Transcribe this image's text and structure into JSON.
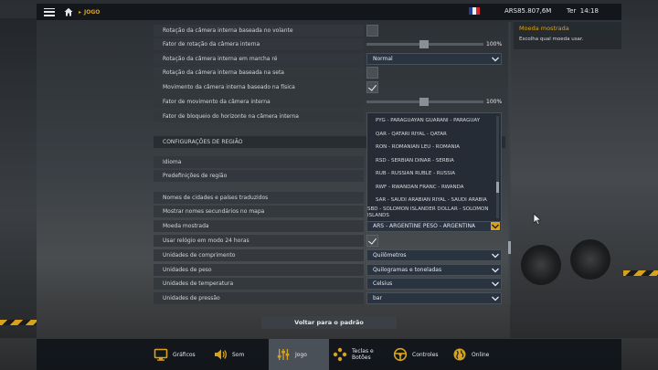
{
  "topbar": {
    "crumb": "JOGO",
    "money": "ARS85.807,6M",
    "clock_day": "Ter",
    "clock_time": "14:18"
  },
  "settings": {
    "rows_top": [
      {
        "label": "Rotação da câmera interna baseada no volante",
        "type": "checkbox",
        "checked": false
      },
      {
        "label": "Fator de rotação da câmera interna",
        "type": "slider",
        "value": 100,
        "display": "100%"
      },
      {
        "label": "Rotação da câmera interna em marcha ré",
        "type": "select",
        "value": "Normal"
      },
      {
        "label": "Rotação da câmera interna baseada na seta",
        "type": "checkbox",
        "checked": false
      },
      {
        "label": "Movimento da câmera interna baseado na física",
        "type": "checkbox",
        "checked": true
      },
      {
        "label": "Fator de movimento da câmera interna",
        "type": "slider",
        "value": 100,
        "display": "100%"
      },
      {
        "label": "Fator de bloqueio do horizonte na câmera interna",
        "type": "none"
      }
    ],
    "section_region": "CONFIGURAÇÕES DE REGIÃO",
    "rows_region": [
      {
        "label": "Idioma"
      },
      {
        "label": "Predefinições de região"
      }
    ],
    "rows_bottom": [
      {
        "label": "Nomes de cidades e países traduzidos",
        "type": "none"
      },
      {
        "label": "Mostrar nomes secundários no mapa",
        "type": "none"
      },
      {
        "label": "Moeda mostrada",
        "type": "select",
        "value": "ARS - ARGENTINE PESO - ARGENTINA",
        "open": true
      },
      {
        "label": "Usar relógio em modo 24 horas",
        "type": "checkbox",
        "checked": true
      },
      {
        "label": "Unidades de comprimento",
        "type": "select",
        "value": "Quilômetros"
      },
      {
        "label": "Unidades de peso",
        "type": "select",
        "value": "Quilogramas e toneladas"
      },
      {
        "label": "Unidades de temperatura",
        "type": "select",
        "value": "Celsius"
      },
      {
        "label": "Unidades de pressão",
        "type": "select",
        "value": "bar"
      }
    ],
    "currency_options": [
      "PYG - PARAGUAYAN GUARANI - PARAGUAY",
      "QAR - QATARI RIYAL - QATAR",
      "RON - ROMANIAN LEU - ROMANIA",
      "RSD - SERBIAN DINAR - SERBIA",
      "RUB - RUSSIAN RUBLE - RUSSIA",
      "RWF - RWANDAN FRANC - RWANDA",
      "SAR - SAUDI ARABIAN RIYAL - SAUDI ARABIA",
      "SBD - SOLOMON ISLANDER DOLLAR - SOLOMON ISLANDS"
    ]
  },
  "description": {
    "title": "Moeda mostrada",
    "body": "Escolha qual moeda usar."
  },
  "reset_label": "Voltar para o padrão",
  "tabs": [
    {
      "label": "Gráficos",
      "icon": "monitor-icon",
      "active": false
    },
    {
      "label": "Som",
      "icon": "speaker-icon",
      "active": false
    },
    {
      "label": "Jogo",
      "icon": "sliders-icon",
      "active": true
    },
    {
      "label": "Teclas e Botões",
      "icon": "gamepad-buttons-icon",
      "active": false
    },
    {
      "label": "Controles",
      "icon": "steering-wheel-icon",
      "active": false
    },
    {
      "label": "Online",
      "icon": "globe-icon",
      "active": false
    }
  ],
  "colors": {
    "accent": "#d9a21c",
    "tab_active": "#4a5058",
    "checkbox_on": "#f0f0f0"
  }
}
